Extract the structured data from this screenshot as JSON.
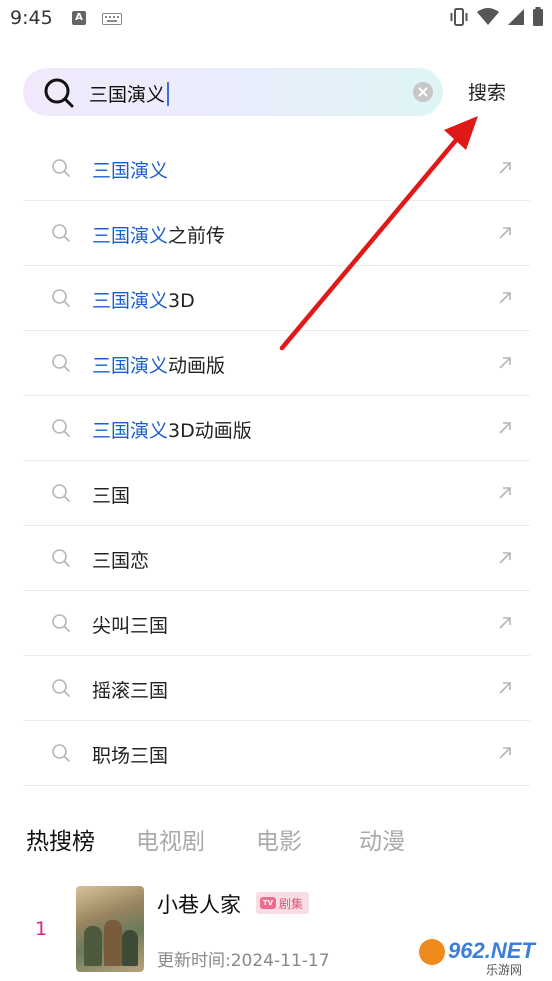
{
  "status_bar": {
    "time": "9:45",
    "keyboard_badge": "A",
    "icons": [
      "vibrate-icon",
      "wifi-icon",
      "cell-signal-icon",
      "battery-icon"
    ]
  },
  "search": {
    "query": "三国演义",
    "submit_label": "搜索",
    "accent_color": "#1a5fd1"
  },
  "suggestions": [
    {
      "highlight": "三国演义",
      "rest": ""
    },
    {
      "highlight": "三国演义",
      "rest": "之前传"
    },
    {
      "highlight": "三国演义",
      "rest": "3D"
    },
    {
      "highlight": "三国演义",
      "rest": "动画版"
    },
    {
      "highlight": "三国演义",
      "rest": "3D动画版"
    },
    {
      "highlight": "",
      "rest": "三国"
    },
    {
      "highlight": "",
      "rest": "三国恋"
    },
    {
      "highlight": "",
      "rest": "尖叫三国"
    },
    {
      "highlight": "",
      "rest": "摇滚三国"
    },
    {
      "highlight": "",
      "rest": "职场三国"
    }
  ],
  "hot": {
    "tabs": [
      "热搜榜",
      "电视剧",
      "电影",
      "动漫"
    ],
    "active_tab": 0,
    "items": [
      {
        "rank": "1",
        "title": "小巷人家",
        "tag": "剧集",
        "tag_icon": "TV",
        "update_label": "更新时间:",
        "update_date": "2024-11-17"
      }
    ]
  },
  "watermark": {
    "text": "962.NET",
    "subtext": "乐游网"
  }
}
